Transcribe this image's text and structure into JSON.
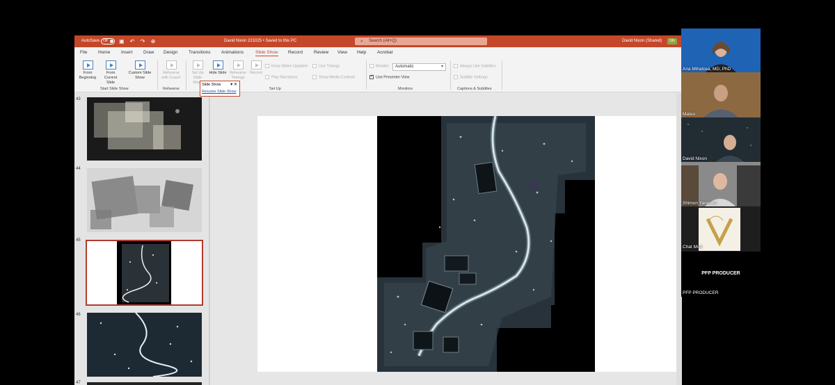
{
  "titlebar": {
    "autosave_label": "AutoSave",
    "autosave_state": "Off",
    "quick_access": "▣ ↶ ↷ ⊕",
    "document_title": "David Nixon 221025 • Saved to this PC",
    "search_placeholder": "Search (Alt+Q)",
    "user_name": "David Nixon (Shared)",
    "user_initials": "DN"
  },
  "menu_tabs": [
    "File",
    "Home",
    "Insert",
    "Draw",
    "Design",
    "Transitions",
    "Animations",
    "Slide Show",
    "Record",
    "Review",
    "View",
    "Help",
    "Acrobat"
  ],
  "active_tab": "Slide Show",
  "ribbon": {
    "from_beginning": "From Beginning",
    "from_current": "From Current Slide",
    "custom_show": "Custom Slide Show",
    "group_start": "Start Slide Show",
    "rehearse": "Rehearse with Coach",
    "group_rehearse": "Rehearse",
    "setup_show": "Set Up Slide Show",
    "hide_slide": "Hide Slide",
    "rehearse_timings": "Rehearse Timings",
    "record": "Record",
    "keep_updated": "Keep Slides Updated",
    "play_narrations": "Play Narrations",
    "use_timings": "Use Timings",
    "show_media_controls": "Show Media Controls",
    "group_setup": "Set Up",
    "monitor_label": "Monitor:",
    "monitor_value": "Automatic",
    "presenter_view": "Use Presenter View",
    "group_monitors": "Monitors",
    "always_subtitles": "Always Use Subtitles",
    "subtitle_settings": "Subtitle Settings",
    "group_captions": "Captions & Subtitles"
  },
  "popup": {
    "title": "Slide Show",
    "link": "Resume Slide Show"
  },
  "slides": [
    {
      "number": "43"
    },
    {
      "number": "44"
    },
    {
      "number": "45"
    },
    {
      "number": "46"
    },
    {
      "number": "47"
    }
  ],
  "selected_slide": "45",
  "participants": [
    {
      "name": "Ana Mihalcea, MD, PhD"
    },
    {
      "name": "Mateo"
    },
    {
      "name": "David Nixon"
    },
    {
      "name": "Shimon Yanowitz"
    },
    {
      "name": "Chat Mod"
    },
    {
      "name": "PFP PRODUCER",
      "caption": "PFP PRODUCER"
    }
  ],
  "colors": {
    "accent": "#c4472a",
    "ribbon_bg": "#f3f3f3",
    "selected_border": "#b03a2e"
  }
}
